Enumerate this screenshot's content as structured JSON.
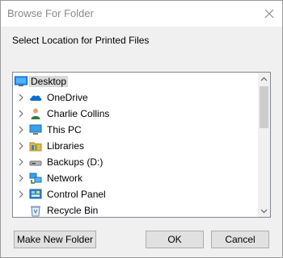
{
  "window": {
    "title": "Browse For Folder",
    "prompt": "Select Location for Printed Files"
  },
  "tree": {
    "selected_index": 0,
    "items": [
      {
        "label": "Desktop",
        "icon": "desktop-icon",
        "expandable": false,
        "selected": true
      },
      {
        "label": "OneDrive",
        "icon": "onedrive-icon",
        "expandable": true
      },
      {
        "label": "Charlie Collins",
        "icon": "user-folder-icon",
        "expandable": true
      },
      {
        "label": "This PC",
        "icon": "this-pc-icon",
        "expandable": true
      },
      {
        "label": "Libraries",
        "icon": "libraries-icon",
        "expandable": true
      },
      {
        "label": "Backups (D:)",
        "icon": "drive-icon",
        "expandable": true
      },
      {
        "label": "Network",
        "icon": "network-icon",
        "expandable": true
      },
      {
        "label": "Control Panel",
        "icon": "control-panel-icon",
        "expandable": true
      },
      {
        "label": "Recycle Bin",
        "icon": "recycle-bin-icon",
        "expandable": false
      }
    ]
  },
  "buttons": {
    "make_new_folder": "Make New Folder",
    "ok": "OK",
    "cancel": "Cancel"
  },
  "colors": {
    "selection": "#d9d9d9",
    "button_face": "#e1e1e1",
    "dialog_bg": "#f0f0f0"
  }
}
